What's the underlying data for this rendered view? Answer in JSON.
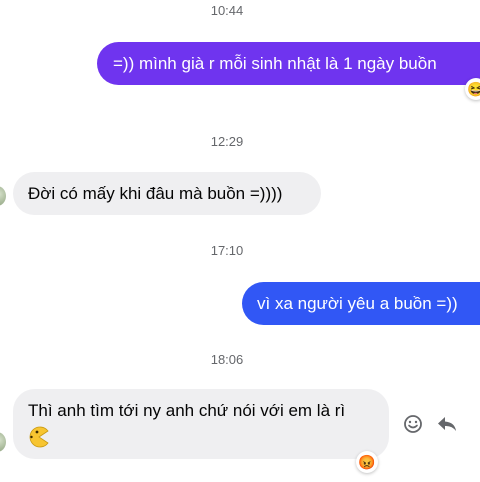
{
  "conversation": {
    "timestamps": [
      "10:44",
      "12:29",
      "17:10",
      "18:06"
    ],
    "messages": [
      {
        "from": "me",
        "text": "=)) mình già r mỗi sinh nhật là 1 ngày buồn",
        "reaction": "laughing-emoji"
      },
      {
        "from": "them",
        "text": "Đời có mấy khi đâu mà buồn =))))"
      },
      {
        "from": "me",
        "text": "vì xa người yêu a buồn =))"
      },
      {
        "from": "them",
        "line1": "Thì anh tìm tới ny anh chứ nói với em là rì",
        "reaction": "angry-emoji"
      }
    ]
  },
  "emoji": {
    "laughing": "😆",
    "angry": "😡"
  },
  "colors": {
    "outgoing_top": "#6a33f0",
    "outgoing_bottom": "#2e5cf6",
    "incoming_bg": "#efeff1"
  }
}
